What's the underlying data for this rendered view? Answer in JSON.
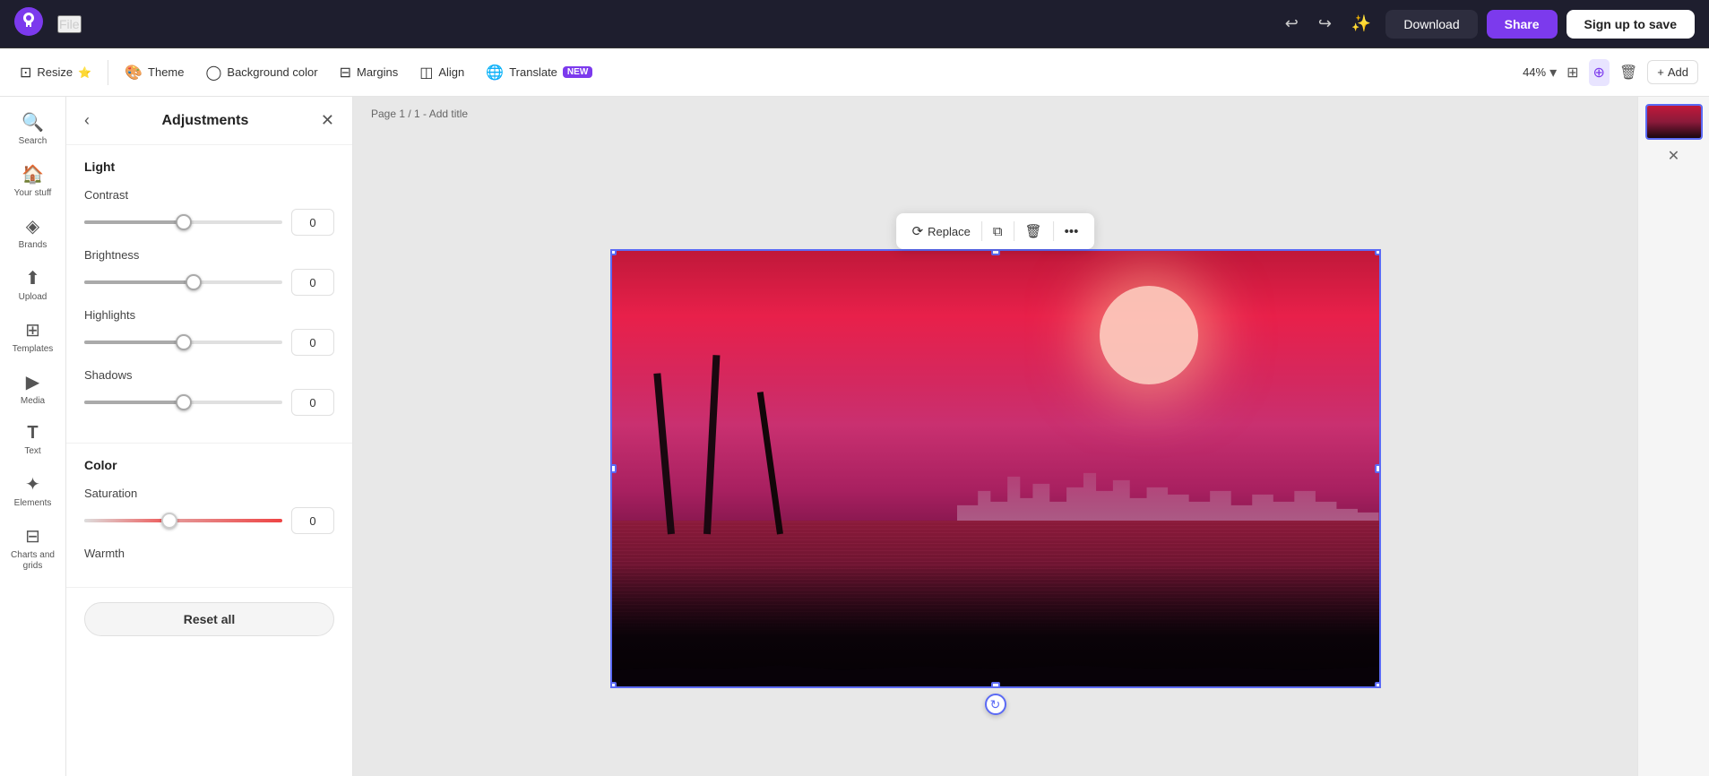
{
  "topbar": {
    "file_label": "File",
    "download_label": "Download",
    "share_label": "Share",
    "signup_label": "Sign up to save"
  },
  "toolbar2": {
    "resize_label": "Resize",
    "theme_label": "Theme",
    "bg_color_label": "Background color",
    "margins_label": "Margins",
    "align_label": "Align",
    "translate_label": "Translate",
    "translate_badge": "NEW",
    "zoom_value": "44%",
    "add_label": "Add"
  },
  "sidebar": {
    "items": [
      {
        "id": "search",
        "icon": "🔍",
        "label": "Search"
      },
      {
        "id": "your-stuff",
        "icon": "🏠",
        "label": "Your stuff"
      },
      {
        "id": "brands",
        "icon": "◈",
        "label": "Brands"
      },
      {
        "id": "upload",
        "icon": "⬆",
        "label": "Upload"
      },
      {
        "id": "templates",
        "icon": "⊞",
        "label": "Templates"
      },
      {
        "id": "media",
        "icon": "▶",
        "label": "Media"
      },
      {
        "id": "text",
        "icon": "T",
        "label": "Text"
      },
      {
        "id": "elements",
        "icon": "✦",
        "label": "Elements"
      },
      {
        "id": "charts-grids",
        "icon": "⊟",
        "label": "Charts and grids"
      }
    ]
  },
  "adjustments": {
    "title": "Adjustments",
    "light_section": "Light",
    "color_section": "Color",
    "contrast_label": "Contrast",
    "contrast_value": "0",
    "contrast_pct": 50,
    "brightness_label": "Brightness",
    "brightness_value": "0",
    "brightness_pct": 55,
    "highlights_label": "Highlights",
    "highlights_value": "0",
    "highlights_pct": 50,
    "shadows_label": "Shadows",
    "shadows_value": "0",
    "shadows_pct": 50,
    "saturation_label": "Saturation",
    "saturation_value": "0",
    "saturation_pct": 43,
    "warmth_label": "Warmth",
    "reset_label": "Reset all"
  },
  "canvas": {
    "page_label": "Page 1 / 1 - Add title"
  },
  "context_toolbar": {
    "replace_label": "Replace"
  }
}
